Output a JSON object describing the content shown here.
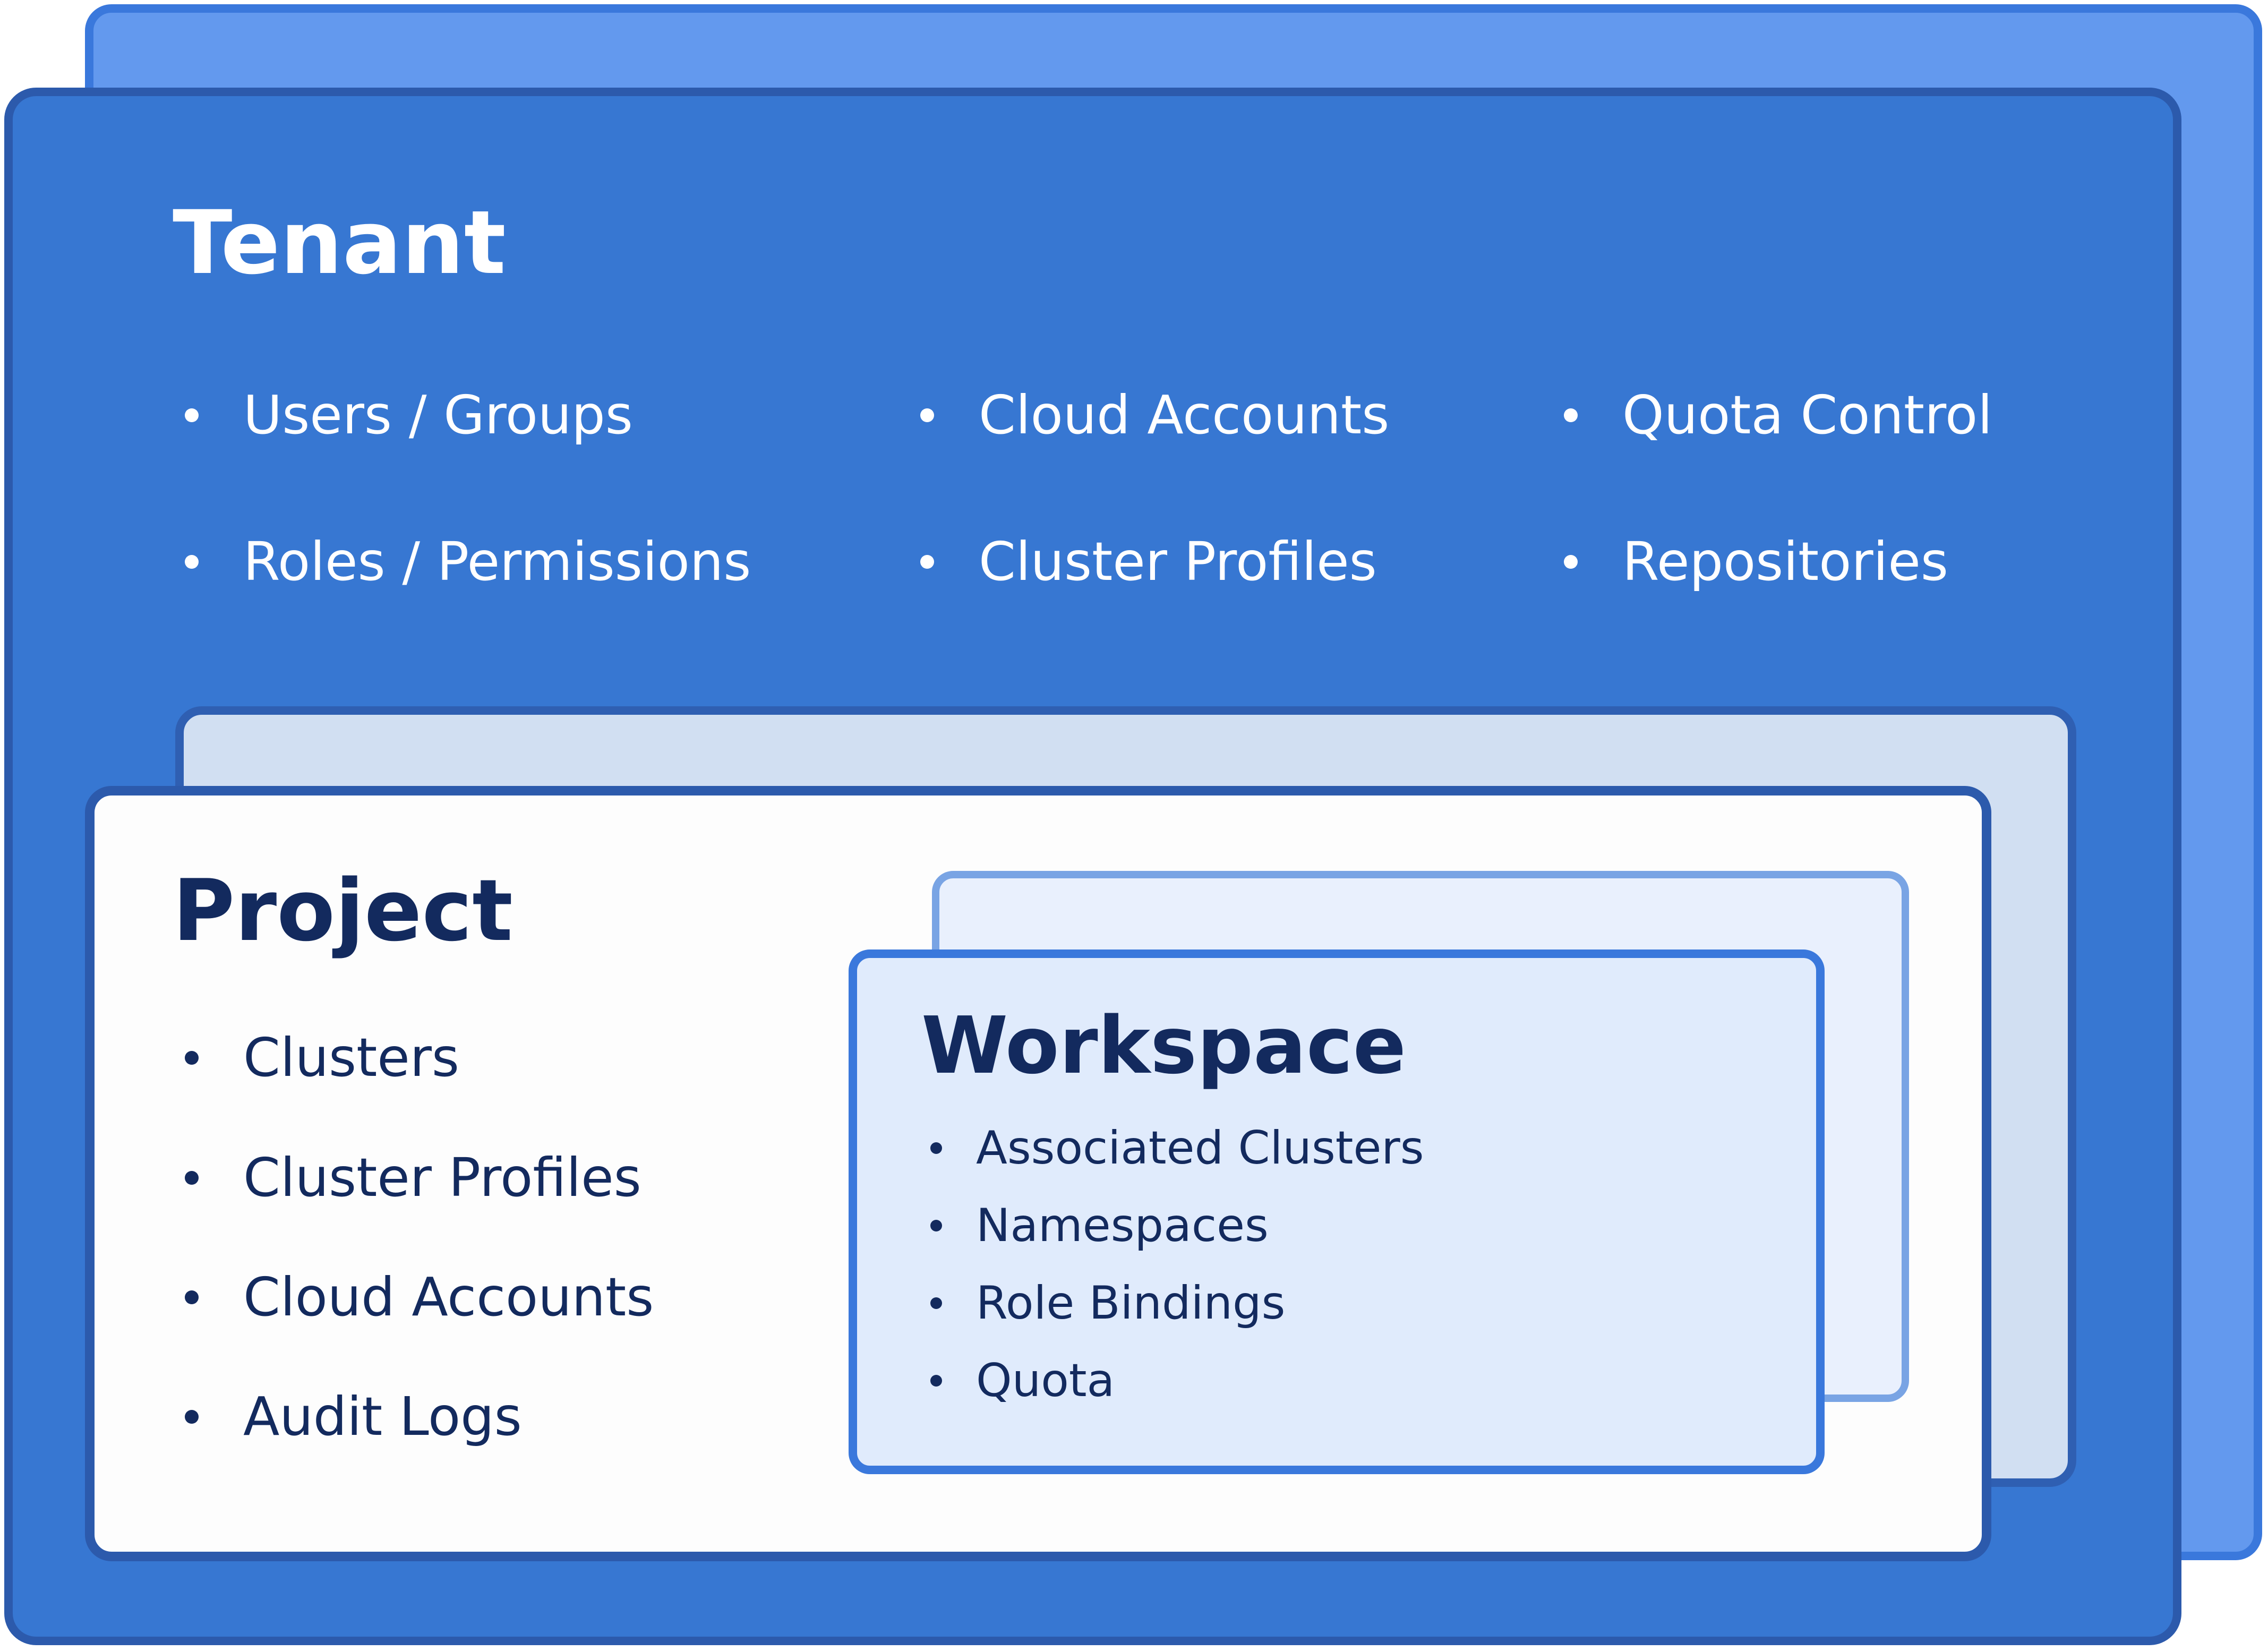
{
  "tenant": {
    "title": "Tenant",
    "items": [
      "Users / Groups",
      "Cloud Accounts",
      "Quota Control",
      "Roles / Permissions",
      "Cluster Profiles",
      "Repositories"
    ]
  },
  "project": {
    "title": "Project",
    "items": [
      "Clusters",
      "Cluster Profiles",
      "Cloud Accounts",
      "Audit Logs"
    ]
  },
  "workspace": {
    "title": "Workspace",
    "items": [
      "Associated Clusters",
      "Namespaces",
      "Role Bindings",
      "Quota"
    ]
  },
  "colors": {
    "tenant_fill": "#3777d2",
    "tenant_back_fill": "#6399ee",
    "project_fill": "#fdfdfd",
    "workspace_fill": "#e0ebfc",
    "dark_text": "#132a5e"
  }
}
